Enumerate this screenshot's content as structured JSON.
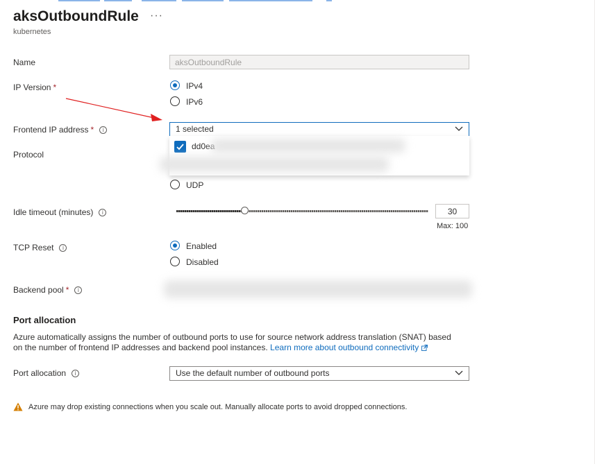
{
  "header": {
    "title": "aksOutboundRule",
    "more_label": "···",
    "subtitle": "kubernetes"
  },
  "form": {
    "name": {
      "label": "Name",
      "value": "aksOutboundRule"
    },
    "ip_version": {
      "label": "IP Version",
      "options": [
        "IPv4",
        "IPv6"
      ],
      "selected": "IPv4"
    },
    "frontend_ip": {
      "label": "Frontend IP address",
      "value": "1 selected",
      "option_visible": "dd0ea"
    },
    "protocol": {
      "label": "Protocol",
      "options_visible": [
        "UDP"
      ]
    },
    "idle_timeout": {
      "label": "Idle timeout (minutes)",
      "value": "30",
      "max_label": "Max: 100",
      "fraction": 0.27
    },
    "tcp_reset": {
      "label": "TCP Reset",
      "options": [
        "Enabled",
        "Disabled"
      ],
      "selected": "Enabled"
    },
    "backend_pool": {
      "label": "Backend pool"
    },
    "port_allocation_section": {
      "heading": "Port allocation",
      "description": "Azure automatically assigns the number of outbound ports to use for source network address translation (SNAT) based on the number of frontend IP addresses and backend pool instances.",
      "link": "Learn more about outbound connectivity"
    },
    "port_allocation": {
      "label": "Port allocation",
      "value": "Use the default number of outbound ports"
    }
  },
  "required_marker": "*",
  "warning": "Azure may drop existing connections when you scale out. Manually allocate ports to avoid dropped connections.",
  "colors": {
    "accent": "#0f6cbd",
    "required": "#a4262c",
    "warning": "#d47f00",
    "annotation_arrow": "#e02020"
  }
}
